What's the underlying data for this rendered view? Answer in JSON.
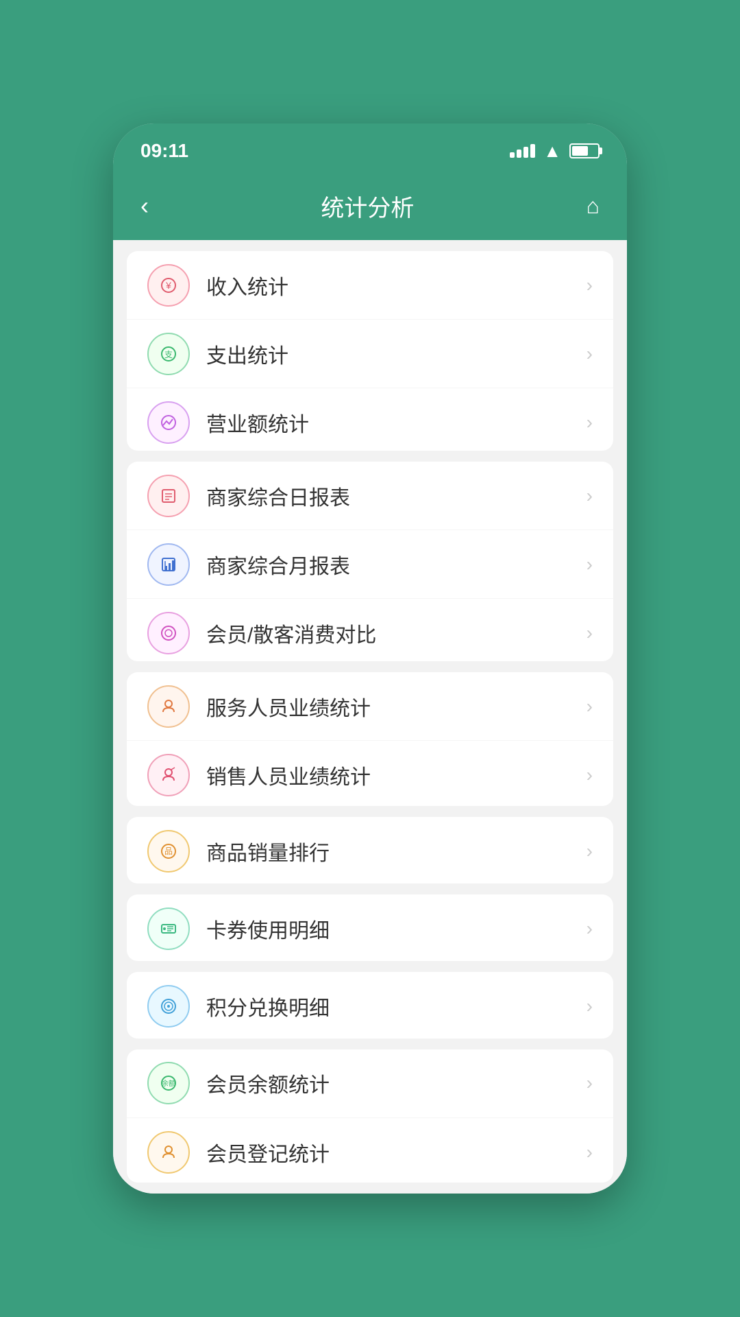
{
  "status": {
    "time": "09:11",
    "signal_bars": [
      4,
      8,
      12,
      16
    ],
    "wifi": "WiFi",
    "battery_level": 65
  },
  "nav": {
    "back_label": "‹",
    "title": "统计分析",
    "home_label": "⌂"
  },
  "sections": [
    {
      "id": "section-stats",
      "items": [
        {
          "id": "income",
          "icon_class": "icon-income",
          "icon_text": "⊕",
          "label": "收入统计"
        },
        {
          "id": "expense",
          "icon_class": "icon-expense",
          "icon_text": "⊖",
          "label": "支出统计"
        },
        {
          "id": "revenue",
          "icon_class": "icon-revenue",
          "icon_text": "↗",
          "label": "营业额统计"
        }
      ]
    },
    {
      "id": "section-reports",
      "items": [
        {
          "id": "daily-report",
          "icon_class": "icon-daily",
          "icon_text": "▦",
          "label": "商家综合日报表"
        },
        {
          "id": "monthly-report",
          "icon_class": "icon-monthly",
          "icon_text": "▤",
          "label": "商家综合月报表"
        },
        {
          "id": "member-compare",
          "icon_class": "icon-member-compare",
          "icon_text": "◎",
          "label": "会员/散客消费对比"
        }
      ]
    },
    {
      "id": "section-staff",
      "items": [
        {
          "id": "service-staff",
          "icon_class": "icon-service",
          "icon_text": "👤",
          "label": "服务人员业绩统计"
        },
        {
          "id": "sales-staff",
          "icon_class": "icon-sales",
          "icon_text": "👤",
          "label": "销售人员业绩统计"
        }
      ]
    },
    {
      "id": "section-product",
      "items": [
        {
          "id": "product-rank",
          "icon_class": "icon-product",
          "icon_text": "◈",
          "label": "商品销量排行"
        }
      ]
    },
    {
      "id": "section-coupon",
      "items": [
        {
          "id": "coupon-detail",
          "icon_class": "icon-coupon",
          "icon_text": "⊞",
          "label": "卡券使用明细"
        }
      ]
    },
    {
      "id": "section-points",
      "items": [
        {
          "id": "points-detail",
          "icon_class": "icon-points",
          "icon_text": "◉",
          "label": "积分兑换明细"
        }
      ]
    },
    {
      "id": "section-member",
      "items": [
        {
          "id": "member-balance",
          "icon_class": "icon-balance",
          "icon_text": "◑",
          "label": "会员余额统计"
        },
        {
          "id": "member-register",
          "icon_class": "icon-register",
          "icon_text": "☺",
          "label": "会员登记统计"
        }
      ]
    }
  ],
  "arrow": "›"
}
